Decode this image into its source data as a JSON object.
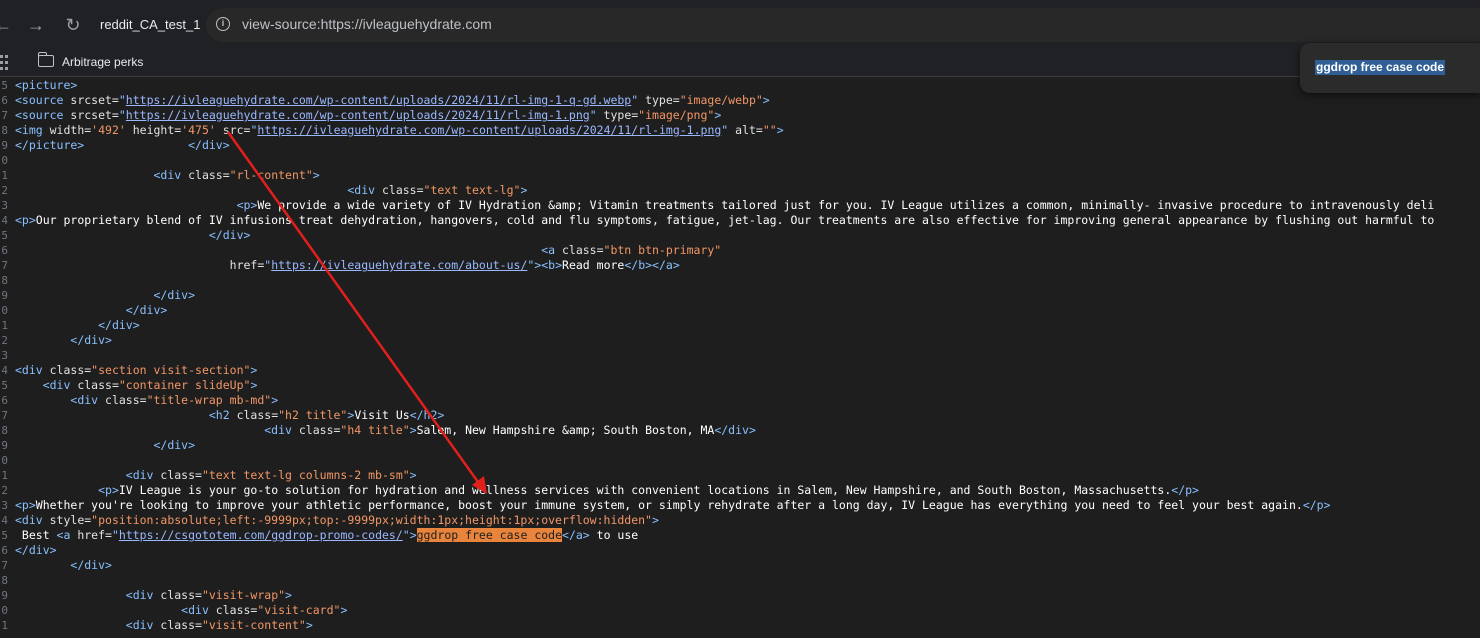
{
  "browser": {
    "back_icon": "←",
    "forward_icon": "→",
    "reload_icon": "↻",
    "tab_title": "reddit_CA_test_1",
    "info_icon": "i",
    "url": "view-source:https://ivleaguehydrate.com",
    "bookmark_folder": "Arbitrage perks"
  },
  "find": {
    "selection_text": "ggdrop free case code"
  },
  "annotation": {
    "arrow_color": "#e0201a"
  },
  "code": {
    "line_numbers": [
      "5",
      "6",
      "7",
      "8",
      "9",
      "0",
      "1",
      "2",
      "3",
      "4",
      "5",
      "6",
      "7",
      "8",
      "9",
      "0",
      "1",
      "2",
      "3",
      "4",
      "5",
      "6",
      "7",
      "8",
      "9",
      "0",
      "1",
      "2",
      "3",
      "4",
      "5",
      "6",
      "7",
      "8",
      "9",
      "0",
      "1"
    ],
    "lines": [
      [
        [
          "t",
          "<picture>"
        ]
      ],
      [
        [
          "t",
          "<source "
        ],
        [
          "a",
          "srcset="
        ],
        [
          "t",
          "\""
        ],
        [
          "l",
          "https://ivleaguehydrate.com/wp-content/uploads/2024/11/rl-img-1-q-gd.webp"
        ],
        [
          "t",
          "\" "
        ],
        [
          "a",
          "type="
        ],
        [
          "v",
          "\"image/webp\""
        ],
        [
          "t",
          ">"
        ]
      ],
      [
        [
          "t",
          "<source "
        ],
        [
          "a",
          "srcset="
        ],
        [
          "t",
          "\""
        ],
        [
          "l",
          "https://ivleaguehydrate.com/wp-content/uploads/2024/11/rl-img-1.png"
        ],
        [
          "t",
          "\" "
        ],
        [
          "a",
          "type="
        ],
        [
          "v",
          "\"image/png\""
        ],
        [
          "t",
          ">"
        ]
      ],
      [
        [
          "t",
          "<img "
        ],
        [
          "a",
          "width="
        ],
        [
          "v",
          "'492'"
        ],
        [
          "t",
          " "
        ],
        [
          "a",
          "height="
        ],
        [
          "v",
          "'475'"
        ],
        [
          "t",
          " "
        ],
        [
          "a",
          "src="
        ],
        [
          "t",
          "\""
        ],
        [
          "l",
          "https://ivleaguehydrate.com/wp-content/uploads/2024/11/rl-img-1.png"
        ],
        [
          "t",
          "\" "
        ],
        [
          "a",
          "alt="
        ],
        [
          "v",
          "\"\""
        ],
        [
          "t",
          ">"
        ]
      ],
      [
        [
          "t",
          "</picture>"
        ],
        [
          "x",
          "               "
        ],
        [
          "t",
          "</div>"
        ]
      ],
      [],
      [
        [
          "x",
          "                    "
        ],
        [
          "t",
          "<div "
        ],
        [
          "a",
          "class="
        ],
        [
          "v",
          "\"rl-content\""
        ],
        [
          "t",
          ">"
        ]
      ],
      [
        [
          "x",
          "                                                "
        ],
        [
          "t",
          "<div "
        ],
        [
          "a",
          "class="
        ],
        [
          "v",
          "\"text text-lg\""
        ],
        [
          "t",
          ">"
        ]
      ],
      [
        [
          "x",
          "                                "
        ],
        [
          "t",
          "<p>"
        ],
        [
          "x",
          "We provide a wide variety of IV Hydration &amp; Vitamin treatments tailored just for you. IV League utilizes a common, minimally- invasive procedure to intravenously deli"
        ]
      ],
      [
        [
          "t",
          "<p>"
        ],
        [
          "x",
          "Our proprietary blend of IV infusions treat dehydration, hangovers, cold and flu symptoms, fatigue, jet-lag. Our treatments are also effective for improving general appearance by flushing out harmful to"
        ]
      ],
      [
        [
          "x",
          "                            "
        ],
        [
          "t",
          "</div>"
        ]
      ],
      [
        [
          "x",
          "                                                                            "
        ],
        [
          "t",
          "<a "
        ],
        [
          "a",
          "class="
        ],
        [
          "v",
          "\"btn btn-primary\""
        ]
      ],
      [
        [
          "x",
          "                               "
        ],
        [
          "a",
          "href="
        ],
        [
          "t",
          "\""
        ],
        [
          "l",
          "https://ivleaguehydrate.com/about-us/"
        ],
        [
          "t",
          "\">"
        ],
        [
          "t",
          "<b>"
        ],
        [
          "x",
          "Read more"
        ],
        [
          "t",
          "</b>"
        ],
        [
          "t",
          "</a>"
        ]
      ],
      [],
      [
        [
          "x",
          "                    "
        ],
        [
          "t",
          "</div>"
        ]
      ],
      [
        [
          "x",
          "                "
        ],
        [
          "t",
          "</div>"
        ]
      ],
      [
        [
          "x",
          "            "
        ],
        [
          "t",
          "</div>"
        ]
      ],
      [
        [
          "x",
          "        "
        ],
        [
          "t",
          "</div>"
        ]
      ],
      [],
      [
        [
          "t",
          "<div "
        ],
        [
          "a",
          "class="
        ],
        [
          "v",
          "\"section visit-section\""
        ],
        [
          "t",
          ">"
        ]
      ],
      [
        [
          "x",
          "    "
        ],
        [
          "t",
          "<div "
        ],
        [
          "a",
          "class="
        ],
        [
          "v",
          "\"container slideUp\""
        ],
        [
          "t",
          ">"
        ]
      ],
      [
        [
          "x",
          "        "
        ],
        [
          "t",
          "<div "
        ],
        [
          "a",
          "class="
        ],
        [
          "v",
          "\"title-wrap mb-md\""
        ],
        [
          "t",
          ">"
        ]
      ],
      [
        [
          "x",
          "                            "
        ],
        [
          "t",
          "<h2 "
        ],
        [
          "a",
          "class="
        ],
        [
          "v",
          "\"h2 title\""
        ],
        [
          "t",
          ">"
        ],
        [
          "x",
          "Visit Us"
        ],
        [
          "t",
          "</h2>"
        ]
      ],
      [
        [
          "x",
          "                                    "
        ],
        [
          "t",
          "<div "
        ],
        [
          "a",
          "class="
        ],
        [
          "v",
          "\"h4 title\""
        ],
        [
          "t",
          ">"
        ],
        [
          "x",
          "Salem, New Hampshire &amp; South Boston, MA"
        ],
        [
          "t",
          "</div>"
        ]
      ],
      [
        [
          "x",
          "                    "
        ],
        [
          "t",
          "</div>"
        ]
      ],
      [],
      [
        [
          "x",
          "                "
        ],
        [
          "t",
          "<div "
        ],
        [
          "a",
          "class="
        ],
        [
          "v",
          "\"text text-lg columns-2 mb-sm\""
        ],
        [
          "t",
          ">"
        ]
      ],
      [
        [
          "x",
          "            "
        ],
        [
          "t",
          "<p>"
        ],
        [
          "x",
          "IV League is your go-to solution for hydration and wellness services with convenient locations in Salem, New Hampshire, and South Boston, Massachusetts."
        ],
        [
          "t",
          "</p>"
        ]
      ],
      [
        [
          "t",
          "<p>"
        ],
        [
          "x",
          "Whether you're looking to improve your athletic performance, boost your immune system, or simply rehydrate after a long day, IV League has everything you need to feel your best again."
        ],
        [
          "t",
          "</p>"
        ]
      ],
      [
        [
          "t",
          "<div "
        ],
        [
          "a",
          "style="
        ],
        [
          "v",
          "\"position:absolute;left:-9999px;top:-9999px;width:1px;height:1px;overflow:hidden\""
        ],
        [
          "t",
          ">"
        ]
      ],
      [
        [
          "x",
          " Best "
        ],
        [
          "t",
          "<a "
        ],
        [
          "a",
          "href="
        ],
        [
          "t",
          "\""
        ],
        [
          "l",
          "https://csgototem.com/ggdrop-promo-codes/"
        ],
        [
          "t",
          "\">"
        ],
        [
          "h",
          "ggdrop free case code"
        ],
        [
          "t",
          "</a>"
        ],
        [
          "x",
          " to use"
        ]
      ],
      [
        [
          "t",
          "</div>"
        ]
      ],
      [
        [
          "x",
          "        "
        ],
        [
          "t",
          "</div>"
        ]
      ],
      [],
      [
        [
          "x",
          "                "
        ],
        [
          "t",
          "<div "
        ],
        [
          "a",
          "class="
        ],
        [
          "v",
          "\"visit-wrap\""
        ],
        [
          "t",
          ">"
        ]
      ],
      [
        [
          "x",
          "                        "
        ],
        [
          "t",
          "<div "
        ],
        [
          "a",
          "class="
        ],
        [
          "v",
          "\"visit-card\""
        ],
        [
          "t",
          ">"
        ]
      ],
      [
        [
          "x",
          "                "
        ],
        [
          "t",
          "<div "
        ],
        [
          "a",
          "class="
        ],
        [
          "v",
          "\"visit-content\""
        ],
        [
          "t",
          ">"
        ]
      ]
    ]
  }
}
